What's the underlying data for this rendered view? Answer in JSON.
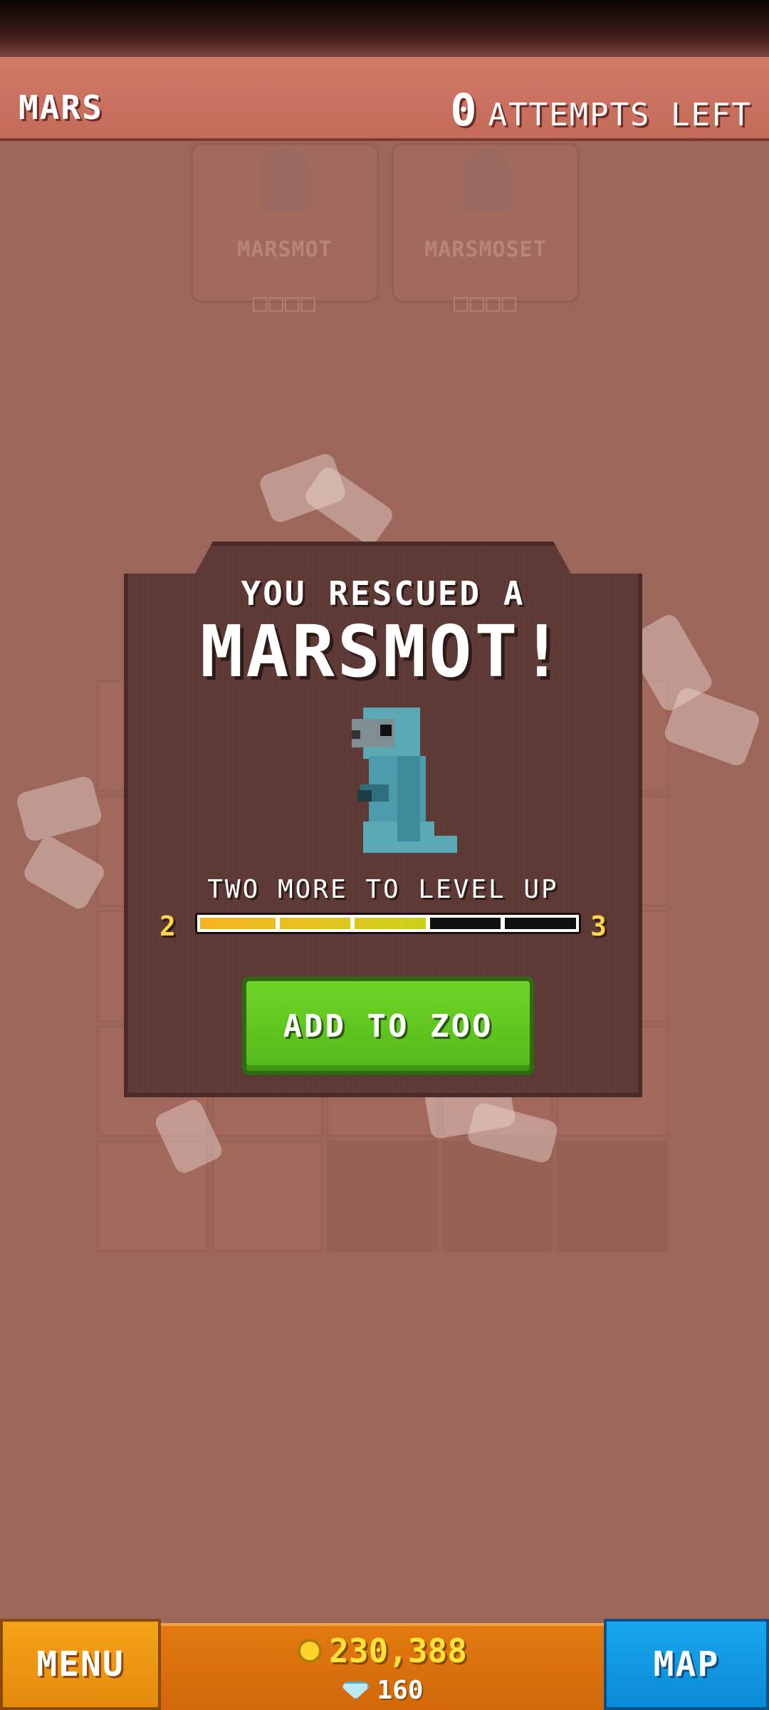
{
  "header": {
    "level_name": "MARS",
    "attempts_count": "0",
    "attempts_label": "ATTEMPTS LEFT"
  },
  "background_cards": [
    {
      "name": "MARSMOT",
      "boxes": "□□□□"
    },
    {
      "name": "MARSMOSET",
      "boxes": "□□□□"
    }
  ],
  "modal": {
    "line1": "YOU RESCUED A",
    "line2": "MARSMOT!",
    "levelup_text": "TWO MORE TO LEVEL UP",
    "level_from": "2",
    "level_to": "3",
    "progress_fraction": 0.6,
    "button_label": "ADD TO ZOO",
    "animal_icon": "marsmot-icon"
  },
  "bottom": {
    "menu_label": "MENU",
    "coins": "230,388",
    "gems": "160",
    "map_label": "MAP"
  },
  "colors": {
    "background": "#9c665a",
    "modal": "#5d3a35",
    "button_green": "#6ed426",
    "coin_yellow": "#ffe23a",
    "map_blue": "#18a7ee",
    "menu_orange": "#f5a319"
  }
}
